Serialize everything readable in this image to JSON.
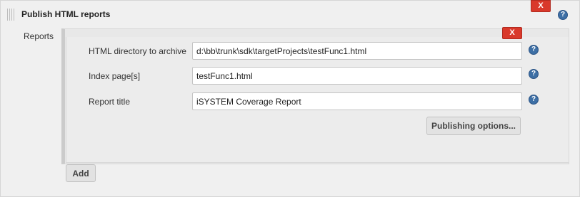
{
  "section": {
    "title": "Publish HTML reports",
    "close_label": "X",
    "help_label": "?"
  },
  "reports": {
    "label": "Reports",
    "close_label": "X",
    "fields": [
      {
        "label": "HTML directory to archive",
        "value": "d:\\bb\\trunk\\sdk\\targetProjects\\testFunc1.html"
      },
      {
        "label": "Index page[s]",
        "value": "testFunc1.html"
      },
      {
        "label": "Report title",
        "value": "iSYSTEM Coverage Report"
      }
    ],
    "help_label": "?",
    "publishing_options_label": "Publishing options...",
    "add_label": "Add"
  },
  "colors": {
    "delete_button": "#d9392b",
    "help_icon": "#3d6fa5",
    "panel_background": "#f0f0f0"
  }
}
